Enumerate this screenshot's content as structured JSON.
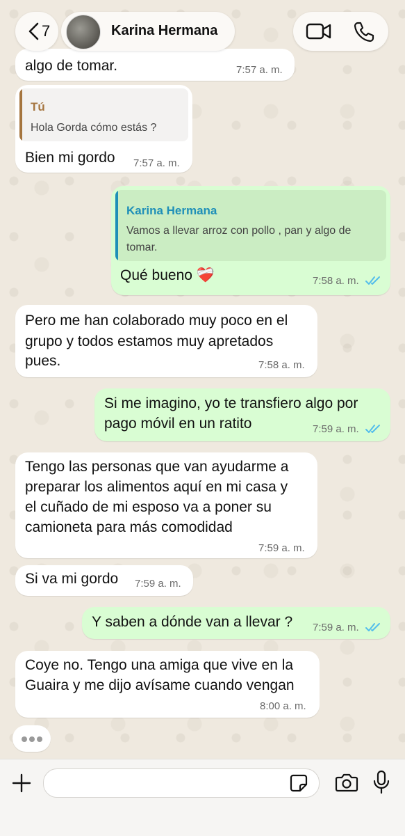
{
  "header": {
    "back_count": "7",
    "contact_name": "Karina Hermana"
  },
  "messages": [
    {
      "dir": "in",
      "text": "algo de tomar.",
      "time": "7:57 a. m."
    },
    {
      "dir": "in",
      "quote_author": "Tú",
      "quote_text": "Hola Gorda cómo estás ?",
      "text": "Bien mi gordo",
      "time": "7:57 a. m."
    },
    {
      "dir": "out",
      "quote_author": "Karina Hermana",
      "quote_lines": [
        "Vamos a llevar arroz con pollo , pan y algo de",
        "tomar."
      ],
      "text": "Qué bueno ❤️‍🩹",
      "time": "7:58 a. m.",
      "status": "read"
    },
    {
      "dir": "in",
      "lines": [
        "Pero me han colaborado muy poco en el",
        "grupo y todos estamos muy apretados",
        "pues."
      ],
      "time": "7:58 a. m."
    },
    {
      "dir": "out",
      "lines": [
        "Si me imagino, yo te transfiero algo por",
        "pago móvil en un ratito"
      ],
      "time": "7:59 a. m.",
      "status": "read"
    },
    {
      "dir": "in",
      "lines": [
        "Tengo las personas que van ayudarme a",
        "preparar los alimentos aquí en mi casa y",
        "el cuñado de mi esposo va a poner su",
        "camioneta para más comodidad"
      ],
      "time": "7:59 a. m."
    },
    {
      "dir": "in",
      "text": "Si va mi gordo",
      "time": "7:59 a. m."
    },
    {
      "dir": "out",
      "text": "Y saben a dónde van a llevar ?",
      "time": "7:59 a. m.",
      "status": "read"
    },
    {
      "dir": "in",
      "lines": [
        "Coye no. Tengo una amiga que vive en la",
        "Guaira y me dijo avísame cuando vengan"
      ],
      "time": "8:00 a. m."
    }
  ],
  "composer": {
    "value": ""
  },
  "colors": {
    "incoming": "#ffffff",
    "outgoing": "#d9fdd3",
    "read_ticks": "#53bdeb",
    "quote_you": "#a5753f",
    "quote_contact": "#1f8fb8",
    "wallpaper": "#efe9df"
  },
  "icons": [
    "chevron-left-icon",
    "video-call-icon",
    "phone-icon",
    "plus-icon",
    "sticker-icon",
    "camera-icon",
    "microphone-icon",
    "double-check-icon",
    "typing-dots-icon"
  ]
}
